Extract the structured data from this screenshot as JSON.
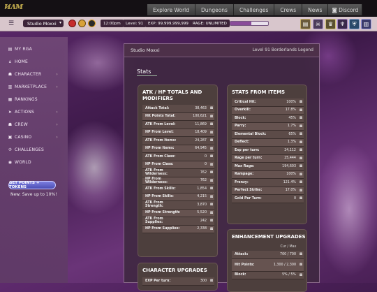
{
  "logo": "ᴎᴧᴍ",
  "topnav": [
    "Explore World",
    "Dungeons",
    "Challenges",
    "Crews",
    "News",
    "Discord"
  ],
  "studio_select": "Studio Moxxi",
  "status": {
    "time": "12:00pm",
    "level": "Level: 91",
    "exp": "EXP: 99,999,999,999",
    "rage": "RAGE: UNLIMITED",
    "rage_fill": 0.55
  },
  "sidebar": {
    "items": [
      {
        "label": "MY RGA",
        "icon": "▤",
        "caret": false
      },
      {
        "label": "HOME",
        "icon": "⌂",
        "caret": false
      },
      {
        "label": "CHARACTER",
        "icon": "☗",
        "caret": true
      },
      {
        "label": "MARKETPLACE",
        "icon": "▥",
        "caret": true
      },
      {
        "label": "RANKINGS",
        "icon": "▦",
        "caret": false
      },
      {
        "label": "ACTIONS",
        "icon": "➤",
        "caret": true
      },
      {
        "label": "CREW",
        "icon": "☗",
        "caret": true
      },
      {
        "label": "CASINO",
        "icon": "▣",
        "caret": true
      },
      {
        "label": "CHALLENGES",
        "icon": "♔",
        "caret": false
      },
      {
        "label": "WORLD",
        "icon": "◉",
        "caret": false
      }
    ],
    "get_points": "GET POINTS + TOKENS",
    "note": "New: Save up to 10%!"
  },
  "main": {
    "title": "Studio Moxxi",
    "subtitle": "Level 91 Borderlands Legend",
    "section": "Stats"
  },
  "cards": {
    "atk": {
      "title_1": "ATK / HP TOTALS AND",
      "title_2": "MODIFIERS",
      "rows": [
        {
          "k": "Attack Total:",
          "v": "38,463"
        },
        {
          "k": "Hit Points Total:",
          "v": "100,621"
        },
        {
          "k": "ATK From Level:",
          "v": "11,869"
        },
        {
          "k": "HP From Level:",
          "v": "18,409"
        },
        {
          "k": "ATK From Items:",
          "v": "24,287"
        },
        {
          "k": "HP From Items:",
          "v": "64,945"
        },
        {
          "k": "ATK From Class:",
          "v": "0"
        },
        {
          "k": "HP From Class:",
          "v": "0"
        },
        {
          "k": "ATK From Wilderness:",
          "v": "762"
        },
        {
          "k": "HP From Wilderness:",
          "v": "762"
        },
        {
          "k": "ATK From Skills:",
          "v": "1,854"
        },
        {
          "k": "HP From Skills:",
          "v": "4,215"
        },
        {
          "k": "ATK From Strength:",
          "v": "3,870"
        },
        {
          "k": "HP From Strength:",
          "v": "5,520"
        },
        {
          "k": "ATK From Supplies:",
          "v": "242"
        },
        {
          "k": "HP From Supplies:",
          "v": "2,338"
        }
      ]
    },
    "items": {
      "title": "STATS FROM ITEMS",
      "rows": [
        {
          "k": "Critical Hit:",
          "v": "100%"
        },
        {
          "k": "Overkill:",
          "v": "17.8%"
        },
        {
          "k": "Block:",
          "v": "45%"
        },
        {
          "k": "Parry:",
          "v": "1.7%"
        },
        {
          "k": "Elemental Block:",
          "v": "65%"
        },
        {
          "k": "Deflect:",
          "v": "1.3%"
        },
        {
          "k": "Exp per turn:",
          "v": "24,112"
        },
        {
          "k": "Rage per turn:",
          "v": "25,444"
        },
        {
          "k": "Max Rage:",
          "v": "194,603"
        },
        {
          "k": "Rampage:",
          "v": "100%"
        },
        {
          "k": "Frenzy:",
          "v": "121.4%"
        },
        {
          "k": "Perfect Strike:",
          "v": "17.0%"
        },
        {
          "k": "Gold Per Turn:",
          "v": "0"
        }
      ]
    },
    "enh": {
      "title": "ENHANCEMENT UPGRADES",
      "col": "Cur / Max",
      "rows": [
        {
          "k": "Attack:",
          "v": "700 / 700"
        },
        {
          "k": "Hit Points:",
          "v": "1,300 / 2,300"
        },
        {
          "k": "Block:",
          "v": "5% / 5%"
        }
      ]
    },
    "char": {
      "title": "CHARACTER UPGRADES",
      "rows": [
        {
          "k": "EXP Per turn:",
          "v": "300"
        }
      ]
    }
  }
}
